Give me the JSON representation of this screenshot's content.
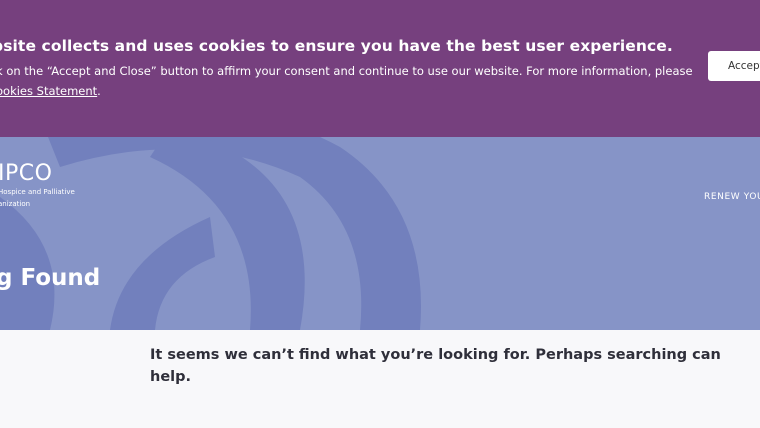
{
  "cookie_banner": {
    "heading": "bsite collects and uses cookies to ensure you have the best user experience.",
    "text_line1": "k on the “Accept and Close” button to affirm your consent and continue to use our website. For more information, please",
    "link_text": "ookies Statement",
    "text_after_link": ".",
    "accept_label": "Accept"
  },
  "header": {
    "logo_mark": "IPCO",
    "logo_line1": "Hospice and Palliative",
    "logo_line2": "anization",
    "renew_label": "RENEW YOU"
  },
  "hero": {
    "title": "g Found"
  },
  "main": {
    "message": "It seems we can’t find what you’re looking for. Perhaps searching can help."
  },
  "colors": {
    "banner": "#76407e",
    "hero": "#8694c7",
    "hero_shape": "#7280bd",
    "page": "#f8f8fa"
  }
}
